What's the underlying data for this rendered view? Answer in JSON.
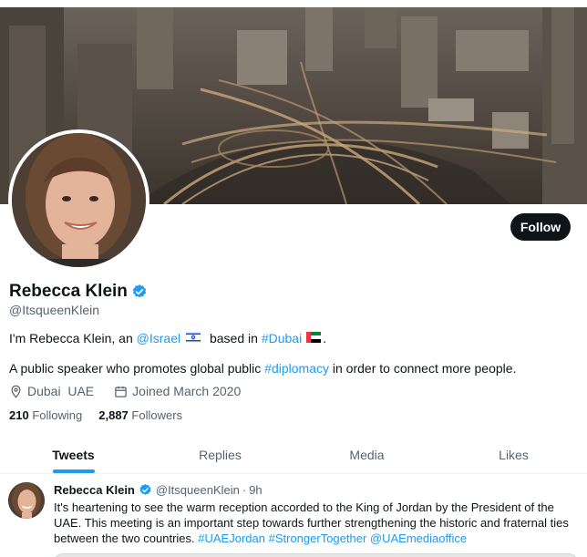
{
  "profile": {
    "name": "Rebecca Klein",
    "handle": "@ItsqueenKlein",
    "follow_label": "Follow",
    "bio": {
      "line1_prefix": "I'm Rebecca Klein, an ",
      "line1_link1": "@Israel",
      "line1_middle": " based in ",
      "line1_link2": "#Dubai",
      "line1_suffix": ".",
      "line2_prefix": "A public speaker who promotes global public ",
      "line2_link": "#diplomacy",
      "line2_suffix": " in order to connect more people."
    },
    "location": "Dubai  UAE",
    "joined": "Joined March 2020",
    "following_count": "210",
    "following_label": "Following",
    "followers_count": "2,887",
    "followers_label": "Followers"
  },
  "tabs": [
    {
      "label": "Tweets",
      "active": true
    },
    {
      "label": "Replies",
      "active": false
    },
    {
      "label": "Media",
      "active": false
    },
    {
      "label": "Likes",
      "active": false
    }
  ],
  "tweet": {
    "name": "Rebecca Klein",
    "handle": "@ItsqueenKlein",
    "dot": "·",
    "time": "9h",
    "text_plain": "It's heartening to see the warm reception accorded to the King of Jordan by the President of the UAE. This meeting is an important step towards further strengthening the historic and fraternal ties between the two countries. ",
    "hashtag1": "#UAEJordan",
    "hashtag2": "#StrongerTogether",
    "mention": "@UAEmediaoffice"
  },
  "icons": {
    "verified": "verified-badge-icon",
    "location": "location-pin-icon",
    "calendar": "calendar-icon",
    "israel_flag": "israel-flag-icon",
    "uae_flag": "uae-flag-icon"
  },
  "colors": {
    "accent": "#1d9bf0",
    "text_primary": "#0f1419",
    "text_secondary": "#536471",
    "follow_bg": "#0f1419"
  }
}
